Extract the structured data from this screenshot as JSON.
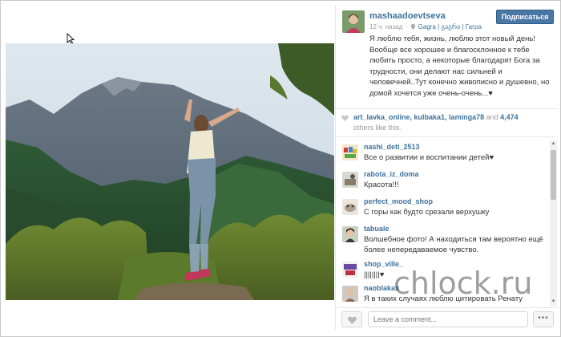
{
  "post": {
    "username": "mashaadoevtseva",
    "follow_label": "Подписаться",
    "time": "12 ч. назад",
    "separator": "·",
    "location": "Gagra | გაგრა | Гагра",
    "caption": "Я люблю тебя, жизнь, люблю этот новый день! Вообще все хорошее и благосклонное к тебе любить просто, а некоторые благодарят Бога за трудности, они делают нас сильней и человечней..Тут конечно живописно и душевно, но домой хочется уже очень-очень...♥"
  },
  "likes": {
    "users": "art_lavka_online, kulbaka1, laminga78",
    "and_text": " and ",
    "count": "4,474",
    "suffix": "others like this."
  },
  "comments": [
    {
      "user": "nashi_deti_2513",
      "text": "Все о развитии и воспитании детей♥"
    },
    {
      "user": "rabota_iz_doma",
      "text": "Красота!!!"
    },
    {
      "user": "perfect_mood_shop",
      "text": "С горы как будто срезали верхушку"
    },
    {
      "user": "tabuale",
      "text": "Волшебное фото! А находиться там вероятно ещё более непередаваемое чувство."
    },
    {
      "user": "shop_ville_",
      "text": "||||||||♥"
    },
    {
      "user": "naoblakax",
      "text": "Я в таких случаях люблю цитировать Ренату Литвинову \"Я в тоске! Я в вазе!\". Но тут важно"
    }
  ],
  "comment_input": {
    "placeholder": "Leave a comment..."
  },
  "more_label": "•••",
  "watermark": "chlock.ru",
  "colors": {
    "link": "#3f729b",
    "follow_button": "#4a78a6",
    "text": "#333333",
    "muted": "#9a9a9a"
  },
  "icons": {
    "heart": "heart-icon",
    "location": "location-pin-icon",
    "cursor": "mouse-cursor-icon"
  }
}
